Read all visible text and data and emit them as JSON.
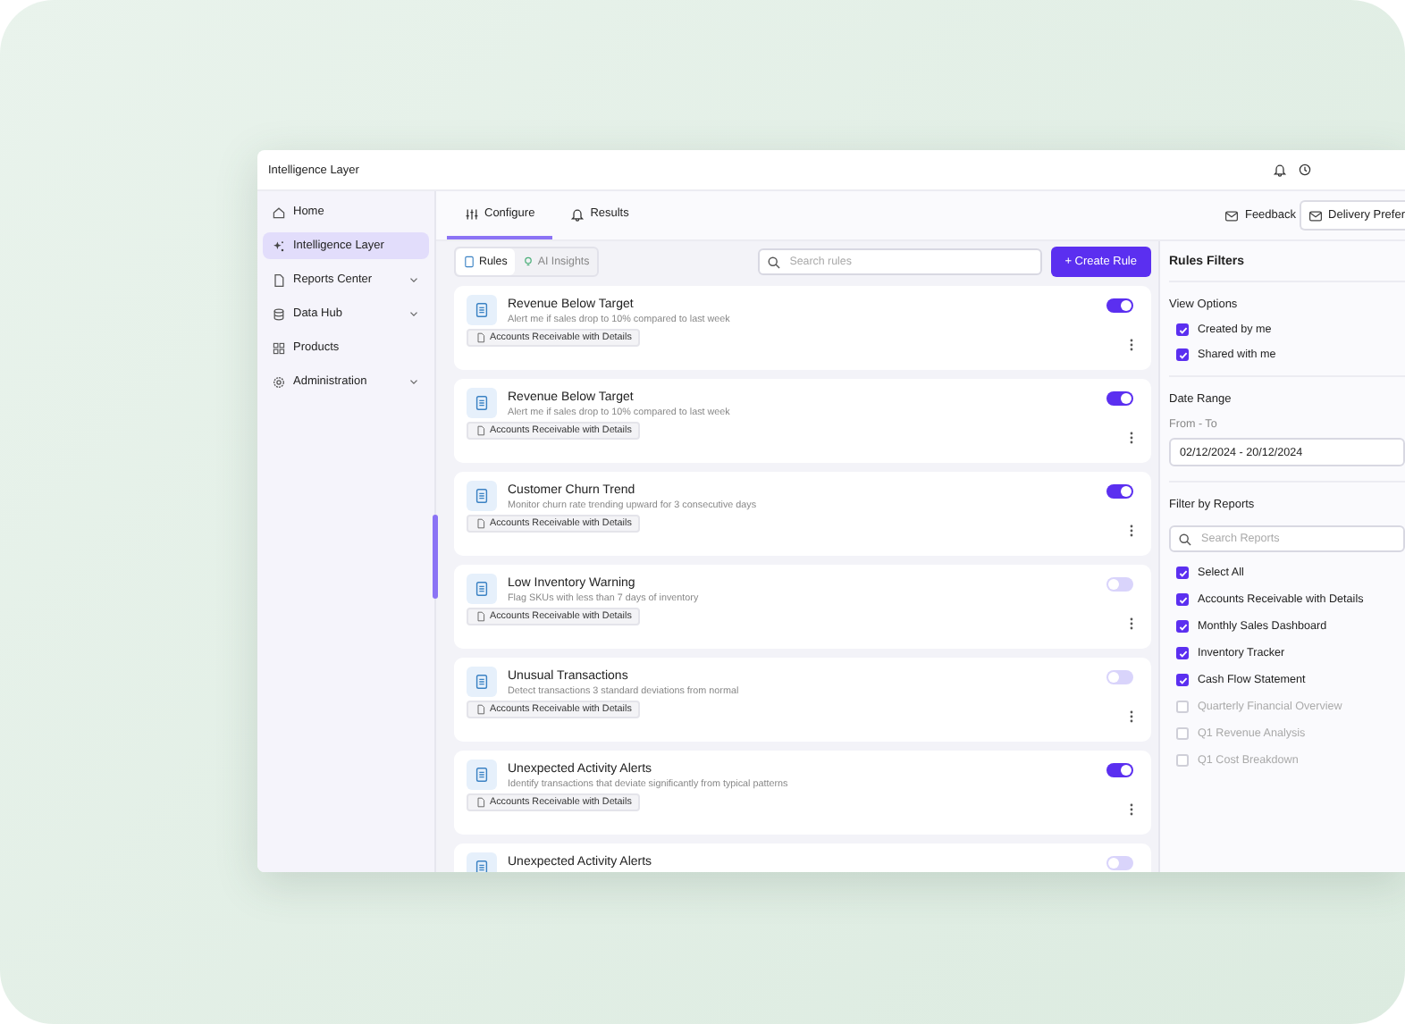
{
  "window": {
    "title": "Intelligence Layer"
  },
  "sidebar": {
    "items": [
      {
        "label": "Home",
        "kind": "link",
        "selected": false
      },
      {
        "label": "Intelligence Layer",
        "kind": "link",
        "selected": true
      },
      {
        "label": "Reports Center",
        "kind": "group",
        "selected": false
      },
      {
        "label": "Data Hub",
        "kind": "group",
        "selected": false
      },
      {
        "label": "Products",
        "kind": "link",
        "selected": false
      },
      {
        "label": "Administration",
        "kind": "group",
        "selected": false
      }
    ]
  },
  "tabs": [
    {
      "label": "Configure",
      "selected": true
    },
    {
      "label": "Results",
      "selected": false
    }
  ],
  "header_actions": [
    {
      "label": "Feedback",
      "kind": "link"
    },
    {
      "label": "Delivery Prefer",
      "kind": "button"
    }
  ],
  "subtabs": [
    {
      "label": "Rules",
      "selected": true
    },
    {
      "label": "AI Insights",
      "selected": false
    }
  ],
  "search": {
    "placeholder": "Search rules"
  },
  "create_button": "+ Create Rule",
  "rules": [
    {
      "title": "Revenue Below Target",
      "description": "Alert me if sales drop to 10% compared to last week",
      "report": "Accounts Receivable with Details",
      "enabled": true
    },
    {
      "title": "Revenue Below Target",
      "description": "Alert me if sales drop to 10% compared to last week",
      "report": "Accounts Receivable with Details",
      "enabled": true
    },
    {
      "title": "Customer Churn Trend",
      "description": "Monitor churn rate trending upward for 3 consecutive days",
      "report": "Accounts Receivable with Details",
      "enabled": true
    },
    {
      "title": "Low Inventory Warning",
      "description": "Flag SKUs with less than 7 days of inventory",
      "report": "Accounts Receivable with Details",
      "enabled": false
    },
    {
      "title": "Unusual Transactions",
      "description": "Detect transactions 3 standard deviations from normal",
      "report": "Accounts Receivable with Details",
      "enabled": false
    },
    {
      "title": "Unexpected Activity Alerts",
      "description": "Identify transactions that deviate significantly from typical patterns",
      "report": "Accounts Receivable with Details",
      "enabled": true
    },
    {
      "title": "Unexpected Activity Alerts",
      "enabled": false
    }
  ],
  "filters": {
    "title": "Rules Filters",
    "view_options": {
      "title": "View Options",
      "options": [
        {
          "label": "Created by me",
          "checked": true
        },
        {
          "label": "Shared with me",
          "checked": true
        }
      ]
    },
    "date_range": {
      "title": "Date Range",
      "label": "From - To",
      "value": "02/12/2024 - 20/12/2024"
    },
    "reports": {
      "title": "Filter by Reports",
      "placeholder": "Search Reports",
      "options": [
        {
          "label": "Select All",
          "checked": true
        },
        {
          "label": "Accounts Receivable with Details",
          "checked": true
        },
        {
          "label": "Monthly Sales Dashboard",
          "checked": true
        },
        {
          "label": "Inventory Tracker",
          "checked": true
        },
        {
          "label": "Cash Flow Statement",
          "checked": true
        },
        {
          "label": "Quarterly Financial Overview",
          "checked": false
        },
        {
          "label": "Q1 Revenue Analysis",
          "checked": false
        },
        {
          "label": "Q1 Cost Breakdown",
          "checked": false
        }
      ]
    }
  }
}
